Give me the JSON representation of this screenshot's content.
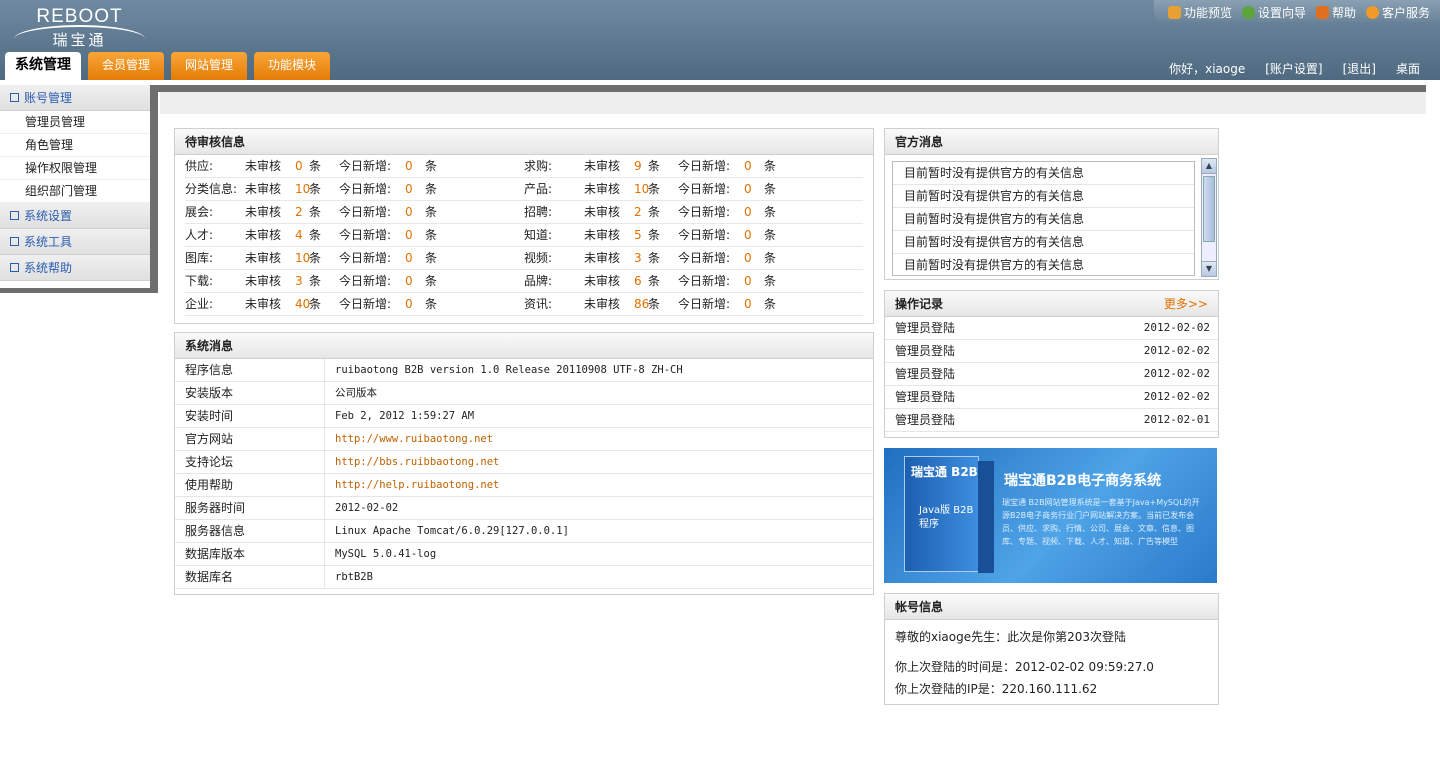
{
  "logo": {
    "en": "REBOOT",
    "cn": "瑞宝通"
  },
  "toplinks": [
    {
      "label": "功能预览",
      "icon": "preview-icon",
      "color": "#e8a030"
    },
    {
      "label": "设置向导",
      "icon": "wizard-icon",
      "color": "#5aa63a"
    },
    {
      "label": "帮助",
      "icon": "help-icon",
      "color": "#e07020"
    },
    {
      "label": "客户服务",
      "icon": "service-icon",
      "color": "#f09a2a"
    }
  ],
  "tabs": [
    "系统管理",
    "会员管理",
    "网站管理",
    "功能模块"
  ],
  "userbar": {
    "greeting": "你好，xiaoge",
    "account": "[账户设置]",
    "logout": "[退出]",
    "desktop": "桌面"
  },
  "sidebar": {
    "group1": "账号管理",
    "items": [
      "管理员管理",
      "角色管理",
      "操作权限管理",
      "组织部门管理"
    ],
    "groups": [
      "系统设置",
      "系统工具",
      "系统帮助"
    ]
  },
  "pending": {
    "title": "待审核信息",
    "unreviewed": "未审核",
    "today": "今日新增:",
    "unit": "条",
    "rows": [
      [
        {
          "name": "供应:",
          "count": "0",
          "today": "0"
        },
        {
          "name": "求购:",
          "count": "9",
          "today": "0"
        }
      ],
      [
        {
          "name": "分类信息:",
          "count": "10",
          "today": "0"
        },
        {
          "name": "产品:",
          "count": "10",
          "today": "0"
        }
      ],
      [
        {
          "name": "展会:",
          "count": "2",
          "today": "0"
        },
        {
          "name": "招聘:",
          "count": "2",
          "today": "0"
        }
      ],
      [
        {
          "name": "人才:",
          "count": "4",
          "today": "0"
        },
        {
          "name": "知道:",
          "count": "5",
          "today": "0"
        }
      ],
      [
        {
          "name": "图库:",
          "count": "10",
          "today": "0"
        },
        {
          "name": "视频:",
          "count": "3",
          "today": "0"
        }
      ],
      [
        {
          "name": "下载:",
          "count": "3",
          "today": "0"
        },
        {
          "name": "品牌:",
          "count": "6",
          "today": "0"
        }
      ],
      [
        {
          "name": "企业:",
          "count": "40",
          "today": "0"
        },
        {
          "name": "资讯:",
          "count": "86",
          "today": "0"
        }
      ]
    ]
  },
  "sysinfo": {
    "title": "系统消息",
    "rows": [
      {
        "k": "程序信息",
        "v": "ruibaotong B2B version 1.0 Release 20110908 UTF-8 ZH-CH",
        "link": false
      },
      {
        "k": "安装版本",
        "v": "公司版本",
        "link": false
      },
      {
        "k": "安装时间",
        "v": "Feb 2, 2012 1:59:27 AM",
        "link": false
      },
      {
        "k": "官方网站",
        "v": "http://www.ruibaotong.net",
        "link": true
      },
      {
        "k": "支持论坛",
        "v": "http://bbs.ruibbaotong.net",
        "link": true
      },
      {
        "k": "使用帮助",
        "v": "http://help.ruibaotong.net",
        "link": true
      },
      {
        "k": "服务器时间",
        "v": "2012-02-02",
        "link": false
      },
      {
        "k": "服务器信息",
        "v": "Linux Apache Tomcat/6.0.29[127.0.0.1]",
        "link": false
      },
      {
        "k": "数据库版本",
        "v": "MySQL 5.0.41-log",
        "link": false
      },
      {
        "k": "数据库名",
        "v": "rbtB2B",
        "link": false
      }
    ]
  },
  "official": {
    "title": "官方消息",
    "items": [
      "目前暂时没有提供官方的有关信息",
      "目前暂时没有提供官方的有关信息",
      "目前暂时没有提供官方的有关信息",
      "目前暂时没有提供官方的有关信息",
      "目前暂时没有提供官方的有关信息"
    ]
  },
  "oplog": {
    "title": "操作记录",
    "more": "更多>>",
    "rows": [
      {
        "action": "管理员登陆",
        "date": "2012-02-02"
      },
      {
        "action": "管理员登陆",
        "date": "2012-02-02"
      },
      {
        "action": "管理员登陆",
        "date": "2012-02-02"
      },
      {
        "action": "管理员登陆",
        "date": "2012-02-02"
      },
      {
        "action": "管理员登陆",
        "date": "2012-02-01"
      }
    ]
  },
  "banner": {
    "title": "瑞宝通B2B电子商务系统",
    "box_title": "瑞宝通 B2B",
    "box_sub": "Java版 B2B 程序",
    "desc": "瑞宝通 B2B网站管理系统是一套基于Java+MySQL的开源B2B电子商务行业门户网站解决方案。当前已发布会员、供应、求购、行情、公司、展会、文章、信息、图库、专题、视频、下载、人才、知道、广告等模型"
  },
  "account": {
    "title": "帐号信息",
    "line1": "尊敬的xiaoge先生：此次是你第203次登陆",
    "line2": "你上次登陆的时间是：2012-02-02 09:59:27.0",
    "line3": "你上次登陆的IP是：220.160.111.62"
  }
}
